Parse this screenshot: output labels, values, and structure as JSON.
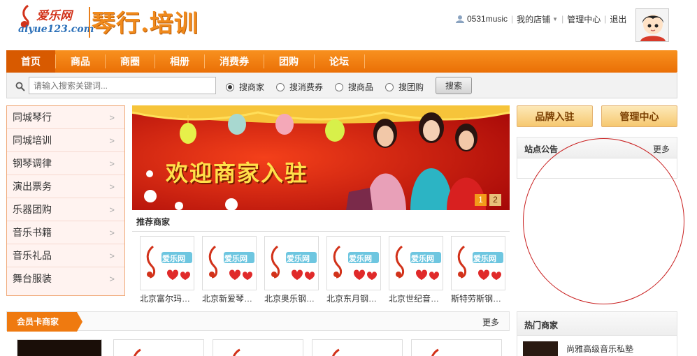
{
  "header": {
    "brand": "爱乐网",
    "url": "aiyue123.com",
    "site_title": "琴行.培训"
  },
  "userbar": {
    "username": "0531music",
    "my_shop": "我的店铺",
    "admin": "管理中心",
    "logout": "退出"
  },
  "nav": {
    "items": [
      {
        "label": "首页",
        "active": true
      },
      {
        "label": "商品"
      },
      {
        "label": "商圈"
      },
      {
        "label": "相册"
      },
      {
        "label": "消费券"
      },
      {
        "label": "团购"
      },
      {
        "label": "论坛"
      }
    ]
  },
  "search": {
    "placeholder": "请输入搜索关键词...",
    "options": [
      {
        "label": "搜商家",
        "selected": true
      },
      {
        "label": "搜消费券",
        "selected": false
      },
      {
        "label": "搜商品",
        "selected": false
      },
      {
        "label": "搜团购",
        "selected": false
      }
    ],
    "button": "搜索"
  },
  "categories": [
    {
      "label": "同城琴行",
      "arrow": ">"
    },
    {
      "label": "同城培训",
      "arrow": ">"
    },
    {
      "label": "钢琴调律",
      "arrow": ">"
    },
    {
      "label": "演出票务",
      "arrow": ">"
    },
    {
      "label": "乐器团购",
      "arrow": ">"
    },
    {
      "label": "音乐书籍",
      "arrow": ">"
    },
    {
      "label": "音乐礼品",
      "arrow": ">"
    },
    {
      "label": "舞台服装",
      "arrow": ">"
    }
  ],
  "banner": {
    "text": "欢迎商家入驻",
    "pages": [
      "1",
      "2"
    ]
  },
  "recommended": {
    "title": "推荐商家",
    "thumb_text": "爱乐网",
    "items": [
      {
        "name": "北京富尔玛…"
      },
      {
        "name": "北京新爱琴…"
      },
      {
        "name": "北京奥乐钢…"
      },
      {
        "name": "北京东月钢…"
      },
      {
        "name": "北京世纪音…"
      },
      {
        "name": "斯特劳斯钢…"
      }
    ]
  },
  "member": {
    "title": "会员卡商家",
    "more": "更多"
  },
  "right": {
    "brand_join": "品牌入驻",
    "admin_center": "管理中心",
    "notice_title": "站点公告",
    "notice_more": "更多",
    "hot_title": "热门商家",
    "hot_item": "尚雅高级音乐私塾"
  },
  "colors": {
    "nav_orange": "#f08410",
    "accent_red": "#c92020",
    "brand_blue": "#2a6fb8"
  }
}
